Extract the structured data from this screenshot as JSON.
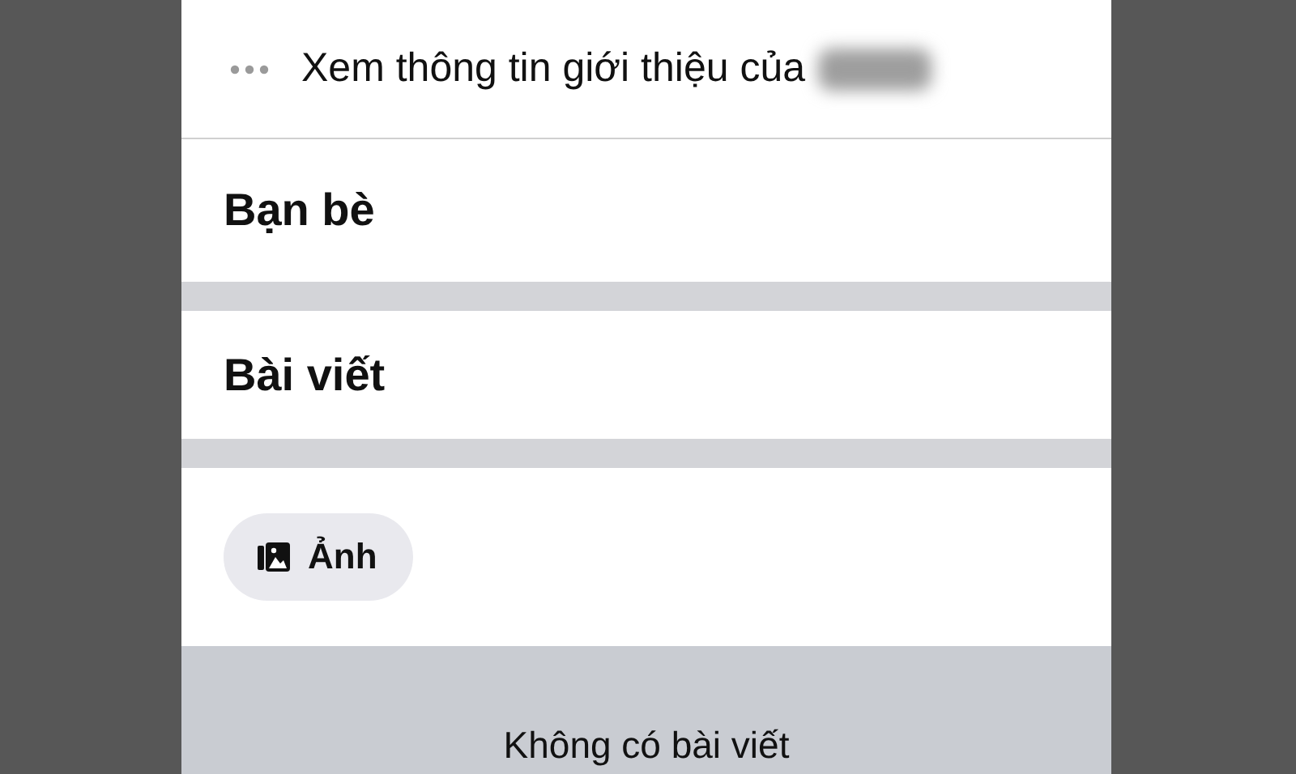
{
  "about_link": {
    "label": "Xem thông tin giới thiệu của"
  },
  "sections": [
    {
      "title": "Bạn bè"
    },
    {
      "title": "Bài viết"
    }
  ],
  "filters": [
    {
      "label": "Ảnh",
      "kind": "photos"
    }
  ],
  "empty_message": "Không có bài viết"
}
